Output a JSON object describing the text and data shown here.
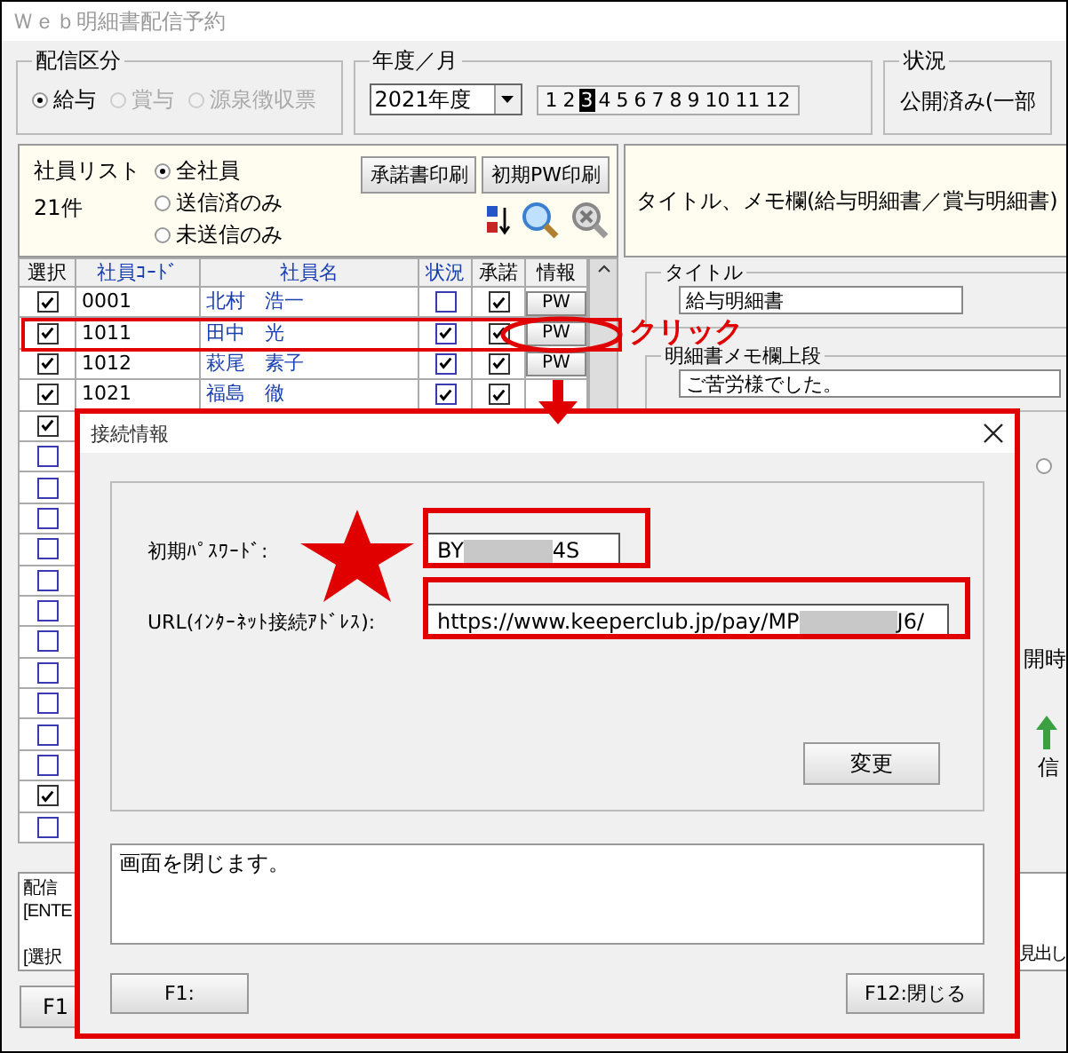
{
  "window": {
    "title": "Ｗｅｂ明細書配信予約"
  },
  "delivery_type": {
    "label": "配信区分",
    "options": [
      {
        "label": "給与",
        "selected": true,
        "disabled": false
      },
      {
        "label": "賞与",
        "selected": false,
        "disabled": true
      },
      {
        "label": "源泉徴収票",
        "selected": false,
        "disabled": true
      }
    ]
  },
  "period": {
    "label": "年度／月",
    "year": "2021年度",
    "months": [
      {
        "label": "1",
        "selected": false
      },
      {
        "label": "2",
        "selected": false
      },
      {
        "label": "3",
        "selected": true
      },
      {
        "label": "4",
        "selected": false
      },
      {
        "label": "5",
        "selected": false
      },
      {
        "label": "6",
        "selected": false
      },
      {
        "label": "7",
        "selected": false
      },
      {
        "label": "8",
        "selected": false
      },
      {
        "label": "9",
        "selected": false
      },
      {
        "label": "10",
        "selected": false
      },
      {
        "label": "11",
        "selected": false
      },
      {
        "label": "12",
        "selected": false
      }
    ]
  },
  "status": {
    "label": "状況",
    "value": "公開済み(一部"
  },
  "employee_list": {
    "label": "社員リスト",
    "count": "21件",
    "filters": [
      {
        "label": "全社員",
        "selected": true
      },
      {
        "label": "送信済のみ",
        "selected": false
      },
      {
        "label": "未送信のみ",
        "selected": false
      }
    ],
    "buttons": [
      "承諾書印刷",
      "初期PW印刷"
    ]
  },
  "table": {
    "columns": [
      "選択",
      "社員ｺｰﾄﾞ",
      "社員名",
      "状況",
      "承諾",
      "情報"
    ],
    "rows": [
      {
        "checked": true,
        "code": "0001",
        "name": "北村　浩一",
        "status_checked": false,
        "consent_checked": true,
        "info_button": "PW"
      },
      {
        "checked": true,
        "code": "1011",
        "name": "田中　光",
        "status_checked": true,
        "consent_checked": true,
        "info_button": "PW"
      },
      {
        "checked": true,
        "code": "1012",
        "name": "萩尾　素子",
        "status_checked": true,
        "consent_checked": true,
        "info_button": "PW"
      },
      {
        "checked": true,
        "code": "1021",
        "name": "福島　徹",
        "status_checked": true,
        "consent_checked": true
      },
      {
        "checked": true
      },
      {
        "checked": false
      },
      {
        "checked": false
      },
      {
        "checked": false
      },
      {
        "checked": false
      },
      {
        "checked": false
      },
      {
        "checked": false
      },
      {
        "checked": false
      },
      {
        "checked": false
      },
      {
        "checked": false
      },
      {
        "checked": false
      },
      {
        "checked": false
      },
      {
        "checked": true
      },
      {
        "checked": false
      }
    ]
  },
  "right_panel": {
    "header": "タイトル、メモ欄(給与明細書／賞与明細書)",
    "title_group": {
      "label": "タイトル",
      "value": "給与明細書"
    },
    "memo_group": {
      "label": "明細書メモ欄上段",
      "value": "ご苦労様でした。"
    },
    "radio": {
      "selected": false
    },
    "fragment_1": "開時",
    "fragment_2": "信"
  },
  "message_box": {
    "lines": [
      "配信",
      "[ENTE",
      "[選択"
    ],
    "right_fragment": "見出し"
  },
  "footer_buttons": [
    "F1"
  ],
  "dialog": {
    "title": "接続情報",
    "password": {
      "label": "初期ﾊﾟｽﾜｰﾄﾞ:",
      "start": "BY",
      "end": "4S"
    },
    "url": {
      "label": "URL(ｲﾝﾀｰﾈｯﾄ接続ｱﾄﾞﾚｽ):",
      "start": "https://www.keeperclub.jp/pay/MP",
      "end": "J6/"
    },
    "change_button": "変更",
    "message": "画面を閉じます。",
    "buttons": [
      "F1:",
      "F12:閉じる"
    ]
  },
  "annotation": {
    "callout": "クリック"
  }
}
